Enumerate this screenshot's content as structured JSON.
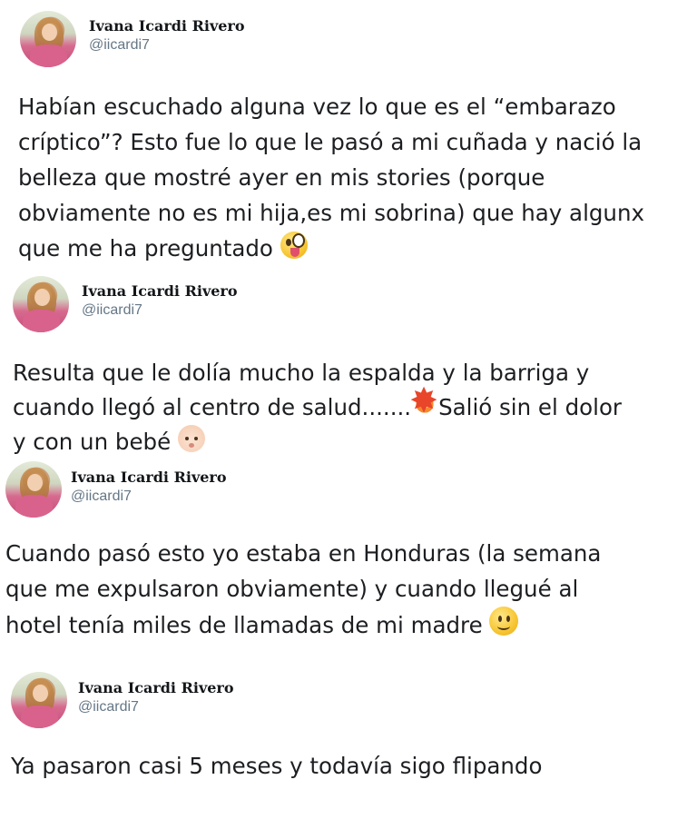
{
  "tweets": [
    {
      "display_name": "Ivana Icardi Rivero",
      "handle": "@iicardi7",
      "lines": [
        "Habían escuchado alguna vez lo que es el “embarazo",
        "críptico”? Esto fue lo que le pasó a mi cuñada y nació la",
        "belleza que mostré ayer en mis stories (porque",
        "obviamente no es mi hija,es mi sobrina) que hay algunx",
        "que me ha preguntado"
      ],
      "emoji": "zany-face-emoji"
    },
    {
      "display_name": "Ivana Icardi Rivero",
      "handle": "@iicardi7",
      "lines": [
        "Resulta que le dolía mucho la espalda y la barriga y",
        "cuando llegó al centro de salud.......",
        "Salió sin el dolor",
        "y con un bebé"
      ],
      "emojis": [
        "collision-emoji",
        "baby-emoji"
      ]
    },
    {
      "display_name": "Ivana Icardi Rivero",
      "handle": "@iicardi7",
      "lines": [
        "Cuando pasó esto yo estaba en Honduras (la semana",
        "que me expulsaron obviamente) y cuando llegué al",
        "hotel tenía miles de llamadas de mi madre"
      ],
      "emoji": "slightly-smiling-face-emoji"
    },
    {
      "display_name": "Ivana Icardi Rivero",
      "handle": "@iicardi7",
      "lines": [
        "Ya pasaron casi 5 meses y todavía sigo flipando"
      ]
    }
  ]
}
